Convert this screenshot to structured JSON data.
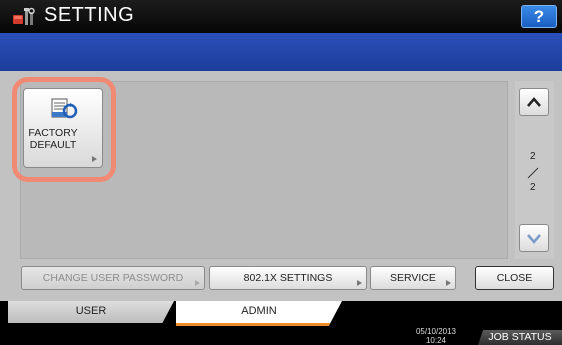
{
  "header": {
    "title": "SETTING",
    "icon": "setting-tools-icon",
    "help_label": "?"
  },
  "main": {
    "factory_default": {
      "label": "FACTORY\nDEFAULT",
      "icon": "factory-default-icon"
    },
    "pagination": {
      "current": "2",
      "separator": "/",
      "total": "2"
    }
  },
  "actions": {
    "change_user_password": "CHANGE USER PASSWORD",
    "dot1x_settings": "802.1X SETTINGS",
    "service": "SERVICE",
    "close": "CLOSE"
  },
  "tabs": [
    {
      "label": "USER",
      "selected": false
    },
    {
      "label": "ADMIN",
      "selected": true
    }
  ],
  "status": {
    "date": "05/10/2013",
    "time": "10:24",
    "job_status": "JOB STATUS"
  },
  "colors": {
    "accent_blue": "#1d3d9c",
    "highlight": "#f08a75",
    "tab_underline": "#ef8c2a",
    "help_button": "#1a5fc2"
  }
}
